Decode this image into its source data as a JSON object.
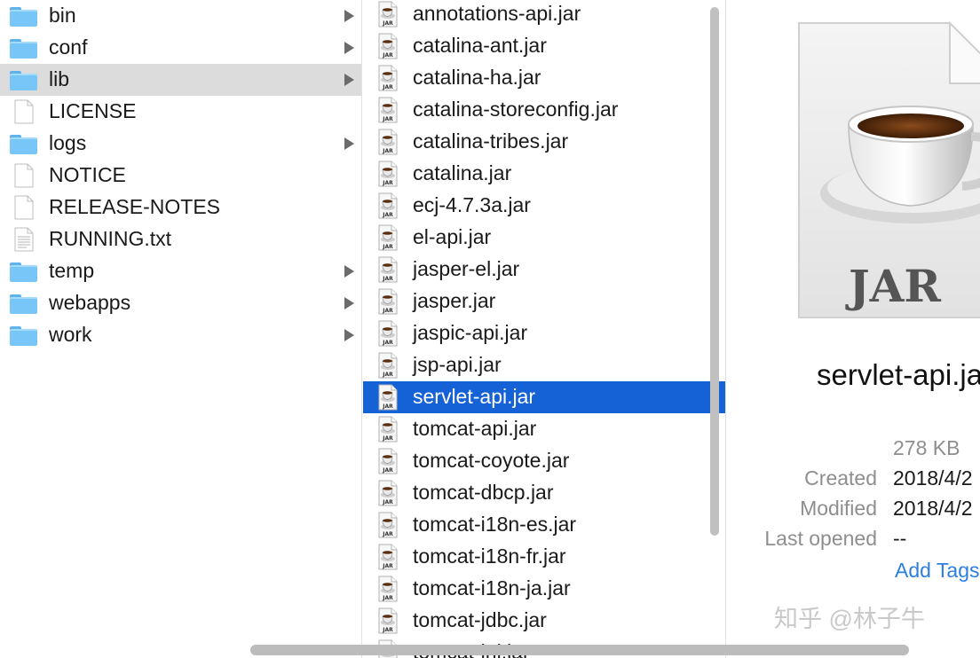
{
  "folder_column": {
    "items": [
      {
        "label": "bin",
        "type": "folder"
      },
      {
        "label": "conf",
        "type": "folder"
      },
      {
        "label": "lib",
        "type": "folder",
        "selected": true
      },
      {
        "label": "LICENSE",
        "type": "file"
      },
      {
        "label": "logs",
        "type": "folder"
      },
      {
        "label": "NOTICE",
        "type": "file"
      },
      {
        "label": "RELEASE-NOTES",
        "type": "file"
      },
      {
        "label": "RUNNING.txt",
        "type": "text-file"
      },
      {
        "label": "temp",
        "type": "folder"
      },
      {
        "label": "webapps",
        "type": "folder"
      },
      {
        "label": "work",
        "type": "folder"
      }
    ]
  },
  "file_column": {
    "items": [
      {
        "label": "annotations-api.jar"
      },
      {
        "label": "catalina-ant.jar"
      },
      {
        "label": "catalina-ha.jar"
      },
      {
        "label": "catalina-storeconfig.jar"
      },
      {
        "label": "catalina-tribes.jar"
      },
      {
        "label": "catalina.jar"
      },
      {
        "label": "ecj-4.7.3a.jar"
      },
      {
        "label": "el-api.jar"
      },
      {
        "label": "jasper-el.jar"
      },
      {
        "label": "jasper.jar"
      },
      {
        "label": "jaspic-api.jar"
      },
      {
        "label": "jsp-api.jar"
      },
      {
        "label": "servlet-api.jar",
        "selected": true
      },
      {
        "label": "tomcat-api.jar"
      },
      {
        "label": "tomcat-coyote.jar"
      },
      {
        "label": "tomcat-dbcp.jar"
      },
      {
        "label": "tomcat-i18n-es.jar"
      },
      {
        "label": "tomcat-i18n-fr.jar"
      },
      {
        "label": "tomcat-i18n-ja.jar"
      },
      {
        "label": "tomcat-jdbc.jar"
      },
      {
        "label": "tomcat-jni.jar"
      }
    ],
    "icon_badge": "JAR"
  },
  "preview": {
    "icon_label": "JAR",
    "filename": "servlet-api.jar",
    "size": "278 KB",
    "created_label": "Created",
    "created_value": "2018/4/2",
    "modified_label": "Modified",
    "modified_value": "2018/4/2",
    "last_opened_label": "Last opened",
    "last_opened_value": "--",
    "add_tags": "Add Tags..."
  },
  "watermark": "知乎 @林子牛",
  "colors": {
    "selection_blue": "#1561d6",
    "folder_blue": "#78c6f7",
    "inactive_selection": "#dcdcdc",
    "link_blue": "#2c7fe0"
  }
}
